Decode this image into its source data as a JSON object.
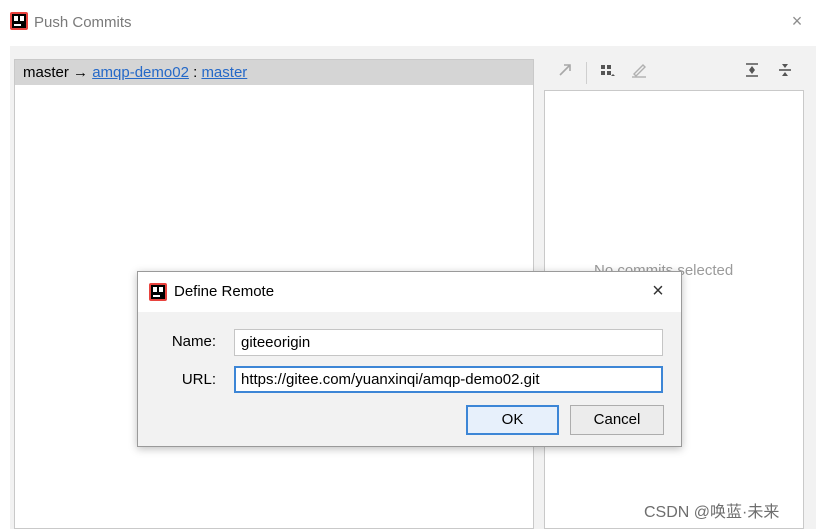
{
  "window": {
    "title": "Push Commits",
    "close_glyph": "×"
  },
  "branch": {
    "local": "master",
    "arrow": "→",
    "remote": "amqp-demo02",
    "separator": ":",
    "remote_branch": "master"
  },
  "toolbar": {
    "icons": [
      "expand-icon",
      "group-by-icon",
      "edit-icon",
      "expand-all-icon",
      "collapse-all-icon"
    ]
  },
  "details": {
    "empty_text": "No commits selected"
  },
  "dialog": {
    "title": "Define Remote",
    "close_glyph": "×",
    "name_label": "Name:",
    "name_value": "giteeorigin",
    "url_label": "URL:",
    "url_value": "https://gitee.com/yuanxinqi/amqp-demo02.git",
    "ok_label": "OK",
    "cancel_label": "Cancel"
  },
  "watermark": "CSDN @唤蓝·未来",
  "colors": {
    "link": "#2569c8",
    "focus": "#3d86d6",
    "selected_row": "#d5d5d5"
  }
}
